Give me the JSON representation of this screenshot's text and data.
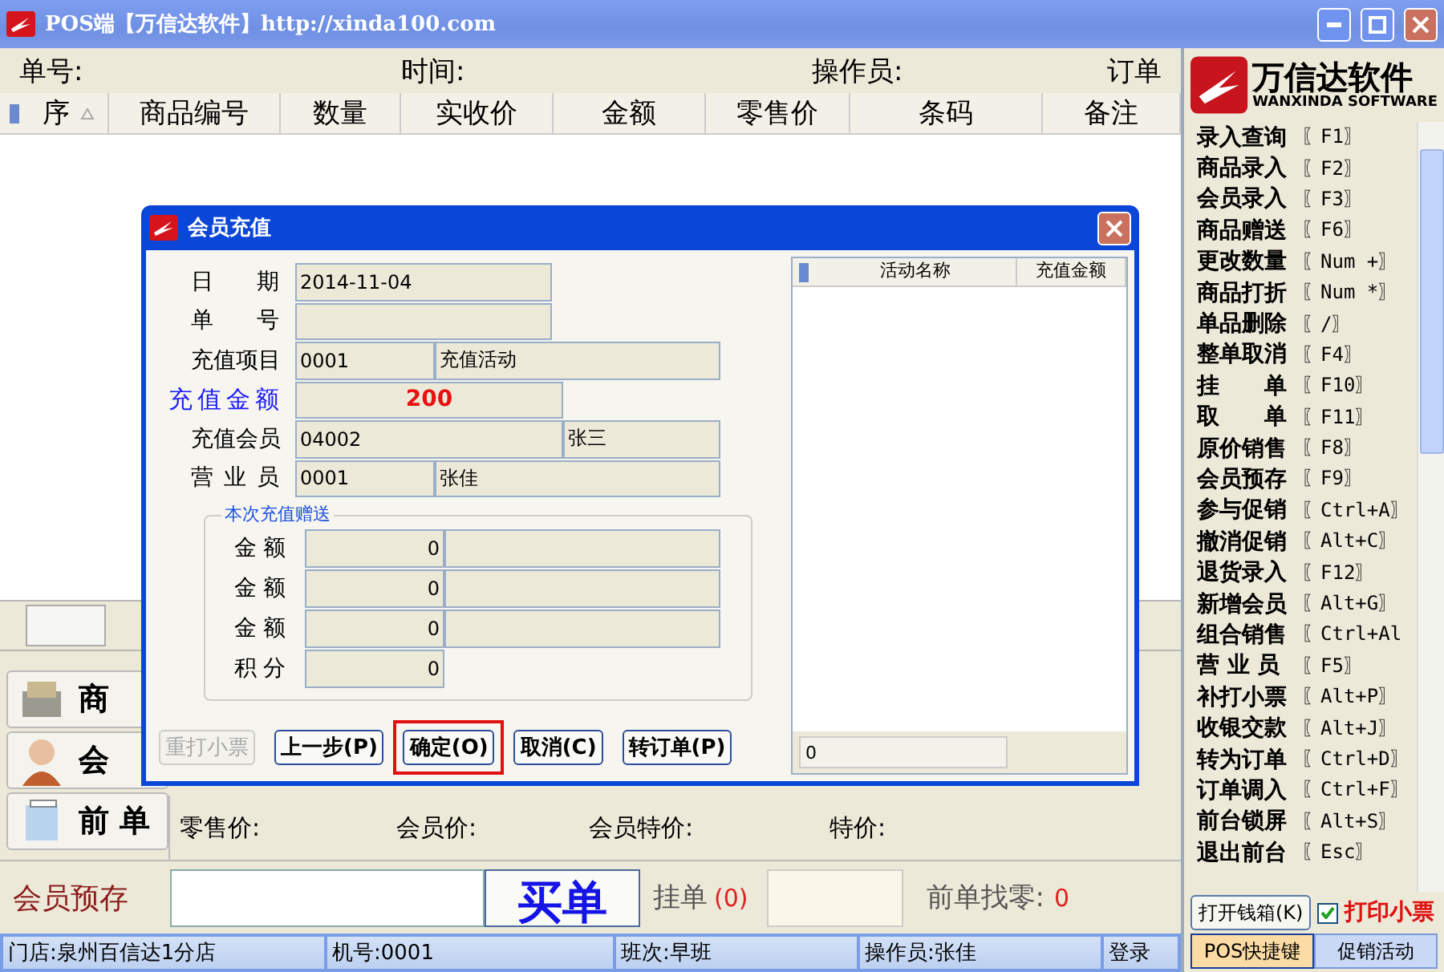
{
  "window": {
    "title": "POS端【万信达软件】http://xinda100.com"
  },
  "info_bar": [
    "单号:",
    "时间:",
    "操作员:",
    "订单"
  ],
  "table": {
    "columns": [
      "序",
      "商品编号",
      "数量",
      "实收价",
      "金额",
      "零售价",
      "条码",
      "备注"
    ]
  },
  "side_tabs": [
    {
      "label": "商",
      "kind": "goods"
    },
    {
      "label": "会",
      "kind": "member"
    },
    {
      "label": "前 单",
      "kind": "order"
    }
  ],
  "price_row": [
    "零售价:",
    "会员价:",
    "会员特价:",
    "特价:"
  ],
  "bottom": {
    "deposit_label": "会员预存",
    "checkout_button": "买单",
    "hold_label": "挂单",
    "hold_count": "(0)",
    "change_label": "前单找零:",
    "change_value": "0"
  },
  "status_bar": [
    "门店:泉州百信达1分店",
    "机号:0001",
    "班次:早班",
    "操作员:张佳",
    "登录"
  ],
  "logo": {
    "name": "万信达软件",
    "subtitle": "WANXINDA SOFTWARE"
  },
  "shortcuts": [
    {
      "label": "录入查询",
      "key": "〖F1〗"
    },
    {
      "label": "商品录入",
      "key": "〖F2〗"
    },
    {
      "label": "会员录入",
      "key": "〖F3〗"
    },
    {
      "label": "商品赠送",
      "key": "〖F6〗"
    },
    {
      "label": "更改数量",
      "key": "〖Num +〗"
    },
    {
      "label": "商品打折",
      "key": "〖Num *〗"
    },
    {
      "label": "单品删除",
      "key": "〖/〗"
    },
    {
      "label": "整单取消",
      "key": "〖F4〗"
    },
    {
      "label": "挂　　单",
      "key": "〖F10〗"
    },
    {
      "label": "取　　单",
      "key": "〖F11〗"
    },
    {
      "label": "原价销售",
      "key": "〖F8〗"
    },
    {
      "label": "会员预存",
      "key": "〖F9〗"
    },
    {
      "label": "参与促销",
      "key": "〖Ctrl+A〗"
    },
    {
      "label": "撤消促销",
      "key": "〖Alt+C〗"
    },
    {
      "label": "退货录入",
      "key": "〖F12〗"
    },
    {
      "label": "新增会员",
      "key": "〖Alt+G〗"
    },
    {
      "label": "组合销售",
      "key": "〖Ctrl+Al"
    },
    {
      "label": "营 业 员",
      "key": "〖F5〗"
    },
    {
      "label": "补打小票",
      "key": "〖Alt+P〗"
    },
    {
      "label": "收银交款",
      "key": "〖Alt+J〗"
    },
    {
      "label": "转为订单",
      "key": "〖Ctrl+D〗"
    },
    {
      "label": "订单调入",
      "key": "〖Ctrl+F〗"
    },
    {
      "label": "前台锁屏",
      "key": "〖Alt+S〗"
    },
    {
      "label": "退出前台",
      "key": "〖Esc〗"
    }
  ],
  "cash_drawer_button": "打开钱箱(K)",
  "print_receipt": {
    "label": "打印小票",
    "checked": true
  },
  "panel_tabs": [
    {
      "label": "POS快捷键",
      "selected": true
    },
    {
      "label": "促销活动",
      "selected": false
    }
  ],
  "dialog": {
    "title": "会员充值",
    "fields": [
      {
        "kind": "text",
        "label": "日期",
        "value": "2014-11-04"
      },
      {
        "kind": "text",
        "label": "单号"
      },
      {
        "kind": "pair",
        "label": "充值项目",
        "value": "0001",
        "name": "充值活动"
      },
      {
        "kind": "amount",
        "label": "充值金额",
        "value": "200"
      },
      {
        "kind": "member",
        "label": "充值会员",
        "value": "04002",
        "name": "张三"
      },
      {
        "kind": "pair",
        "label": "营业员",
        "value": "0001",
        "name": "张佳"
      }
    ],
    "gift_group": {
      "title": "本次充值赠送",
      "rows": [
        {
          "kind": "amount",
          "label": "金额",
          "value": "0"
        },
        {
          "kind": "amount",
          "label": "金额",
          "value": "0"
        },
        {
          "kind": "amount",
          "label": "金额",
          "value": "0"
        },
        {
          "kind": "points",
          "label": "积分",
          "value": "0"
        }
      ]
    },
    "buttons": [
      {
        "label": "重打小票",
        "disabled": true,
        "highlighted": false
      },
      {
        "label": "上一步(P)",
        "disabled": false,
        "highlighted": false
      },
      {
        "label": "确定(O)",
        "disabled": false,
        "highlighted": true
      },
      {
        "label": "取消(C)",
        "disabled": false,
        "highlighted": false
      },
      {
        "label": "转订单(P)",
        "disabled": false,
        "highlighted": false
      }
    ],
    "list": {
      "columns": [
        "活动名称",
        "充值金额"
      ],
      "footer": "0"
    }
  }
}
